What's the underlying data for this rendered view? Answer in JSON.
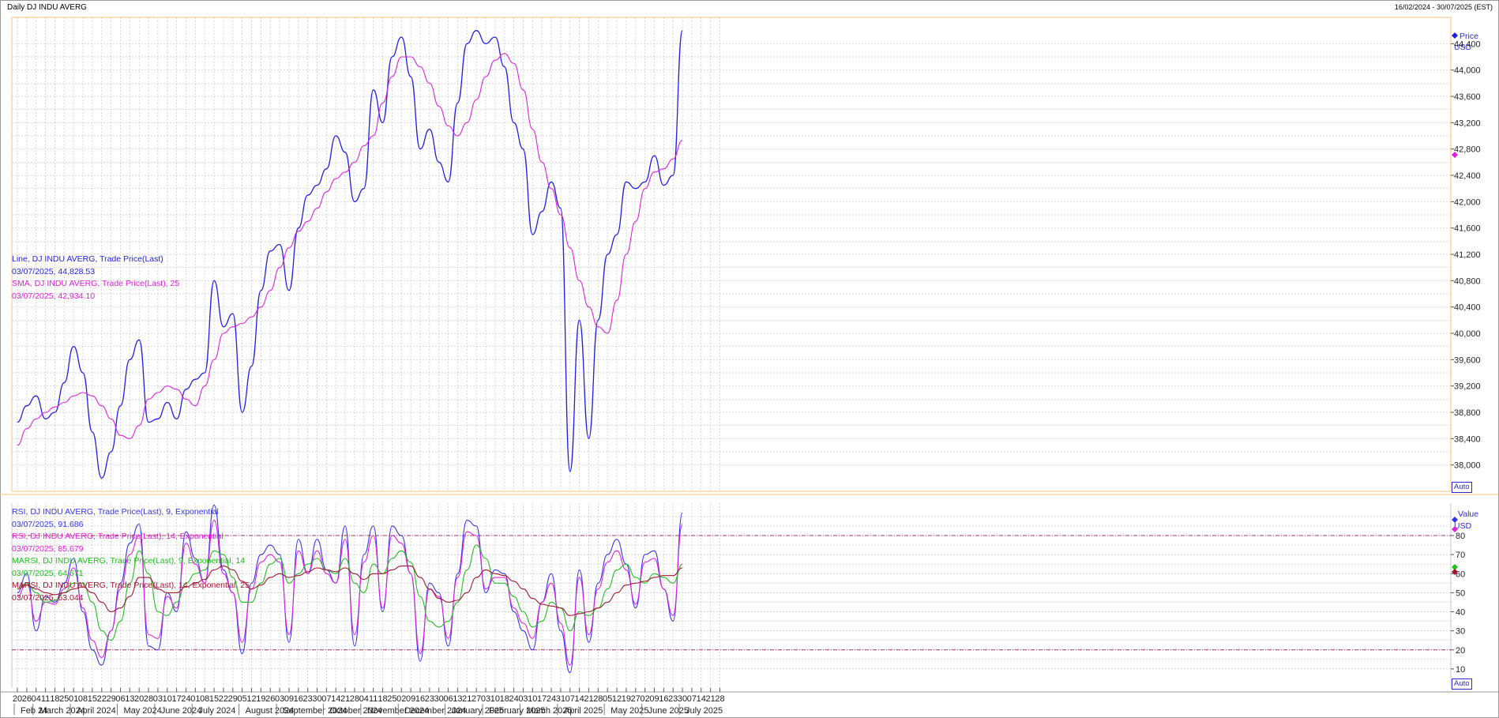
{
  "header": {
    "title": "Daily DJ INDU AVERG",
    "range": "16/02/2024 - 30/07/2025 (EST)"
  },
  "colors": {
    "price": "#1f1fe0",
    "sma": "#e020e0",
    "rsi9": "#3535e8",
    "rsi14": "#e020e0",
    "marsi9": "#20c020",
    "marsi14": "#a01830",
    "refline": "#b03050",
    "grid": "#c6c6c6",
    "selection": "#f5c27a"
  },
  "price_panel": {
    "series_label": "Price",
    "unit": "USD",
    "auto": "Auto",
    "annotations": [
      {
        "text": "Line, DJ INDU AVERG, Trade Price(Last)",
        "color": "#1f1fe0"
      },
      {
        "text": "03/07/2025, 44,828.53",
        "color": "#1f1fe0"
      },
      {
        "text": "SMA, DJ INDU AVERG, Trade Price(Last),  25",
        "color": "#e020e0"
      },
      {
        "text": "03/07/2025, 42,934.10",
        "color": "#e020e0"
      }
    ],
    "y_ticks": [
      "44,400",
      "44,000",
      "43,600",
      "43,200",
      "42,800",
      "42,400",
      "42,000",
      "41,600",
      "41,200",
      "40,800",
      "40,400",
      "40,000",
      "39,600",
      "39,200",
      "38,800",
      "38,400",
      "38,000"
    ]
  },
  "indicator_panel": {
    "series_label": "Value",
    "unit": "USD",
    "auto": "Auto",
    "annotations": [
      {
        "text": "RSI, DJ INDU AVERG, Trade Price(Last),  9, Exponential",
        "color": "#3535e8"
      },
      {
        "text": "03/07/2025, 91.686",
        "color": "#3535e8"
      },
      {
        "text": "RSI, DJ INDU AVERG, Trade Price(Last),  14, Exponential",
        "color": "#e020e0"
      },
      {
        "text": "03/07/2025, 85.679",
        "color": "#e020e0"
      },
      {
        "text": "MARSI, DJ INDU AVERG, Trade Price(Last),  9, Exponential, 14",
        "color": "#20c020"
      },
      {
        "text": "03/07/2025, 64.671",
        "color": "#20c020"
      },
      {
        "text": "MARSI, DJ INDU AVERG, Trade Price(Last),  14, Exponential, 25",
        "color": "#a01830"
      },
      {
        "text": "03/07/2025, 63.044",
        "color": "#a01830"
      }
    ],
    "y_ticks": [
      "80",
      "70",
      "60",
      "50",
      "40",
      "30",
      "20",
      "10"
    ]
  },
  "x_axis": {
    "days": [
      "20",
      "26",
      "04",
      "11",
      "18",
      "25",
      "01",
      "08",
      "15",
      "22",
      "29",
      "06",
      "13",
      "20",
      "28",
      "03",
      "10",
      "17",
      "24",
      "01",
      "08",
      "15",
      "22",
      "29",
      "05",
      "12",
      "19",
      "26",
      "03",
      "09",
      "16",
      "23",
      "30",
      "07",
      "14",
      "21",
      "28",
      "04",
      "11",
      "18",
      "25",
      "02",
      "09",
      "16",
      "23",
      "30",
      "06",
      "13",
      "21",
      "27",
      "03",
      "10",
      "18",
      "24",
      "03",
      "10",
      "17",
      "24",
      "31",
      "07",
      "14",
      "21",
      "28",
      "05",
      "12",
      "19",
      "27",
      "02",
      "09",
      "16",
      "23",
      "30",
      "07",
      "14",
      "21",
      "28"
    ],
    "months": [
      "Feb 24",
      "March 2024",
      "April 2024",
      "May 2024",
      "June 2024",
      "July 2024",
      "August 2024",
      "September 2024",
      "October 2024",
      "November 2024",
      "December 2024",
      "January 2025",
      "February 2025",
      "March 2025",
      "April 2025",
      "May 2025",
      "June 2025",
      "July 2025"
    ]
  },
  "chart_data": [
    {
      "type": "line",
      "title": "Daily DJ INDU AVERG",
      "date_range": "16/02/2024 - 30/07/2025",
      "ylabel": "Price USD",
      "ylim": [
        37600,
        44800
      ],
      "grid": true,
      "x_dates_weekly": [
        "2024-02-20",
        "2024-02-26",
        "2024-03-04",
        "2024-03-11",
        "2024-03-18",
        "2024-03-25",
        "2024-04-01",
        "2024-04-08",
        "2024-04-15",
        "2024-04-22",
        "2024-04-29",
        "2024-05-06",
        "2024-05-13",
        "2024-05-20",
        "2024-05-28",
        "2024-06-03",
        "2024-06-10",
        "2024-06-17",
        "2024-06-24",
        "2024-07-01",
        "2024-07-08",
        "2024-07-15",
        "2024-07-22",
        "2024-07-29",
        "2024-08-05",
        "2024-08-12",
        "2024-08-19",
        "2024-08-26",
        "2024-09-03",
        "2024-09-09",
        "2024-09-16",
        "2024-09-23",
        "2024-09-30",
        "2024-10-07",
        "2024-10-14",
        "2024-10-21",
        "2024-10-28",
        "2024-11-04",
        "2024-11-11",
        "2024-11-18",
        "2024-11-25",
        "2024-12-02",
        "2024-12-09",
        "2024-12-16",
        "2024-12-23",
        "2024-12-30",
        "2025-01-06",
        "2025-01-13",
        "2025-01-21",
        "2025-01-27",
        "2025-02-03",
        "2025-02-10",
        "2025-02-18",
        "2025-02-24",
        "2025-03-03",
        "2025-03-10",
        "2025-03-17",
        "2025-03-24",
        "2025-03-31",
        "2025-04-07",
        "2025-04-14",
        "2025-04-21",
        "2025-04-28",
        "2025-05-05",
        "2025-05-12",
        "2025-05-19",
        "2025-05-27",
        "2025-06-02",
        "2025-06-09",
        "2025-06-16",
        "2025-06-23",
        "2025-06-30"
      ],
      "series": [
        {
          "name": "Line, DJ INDU AVERG, Trade Price(Last)",
          "values": [
            38650,
            38900,
            39050,
            38700,
            38800,
            39250,
            39800,
            39400,
            38500,
            37800,
            38200,
            38900,
            39600,
            39900,
            38650,
            38700,
            38950,
            38700,
            39150,
            39300,
            39400,
            40800,
            40100,
            40300,
            38800,
            39500,
            40650,
            41250,
            41350,
            40650,
            41600,
            42100,
            42250,
            42500,
            43000,
            42750,
            42000,
            42200,
            43700,
            43200,
            44200,
            44500,
            43900,
            42800,
            43100,
            42600,
            42300,
            43500,
            44400,
            44600,
            44400,
            44500,
            44050,
            43200,
            42800,
            41500,
            41850,
            42300,
            41900,
            37900,
            40200,
            38400,
            40200,
            41200,
            41500,
            42300,
            42200,
            42300,
            42700,
            42250,
            42400,
            44600
          ]
        },
        {
          "name": "SMA, DJ INDU AVERG, Trade Price(Last), 25",
          "values": [
            38300,
            38550,
            38700,
            38800,
            38880,
            38950,
            39050,
            39100,
            39050,
            38900,
            38700,
            38450,
            38400,
            38600,
            39000,
            39100,
            39200,
            39150,
            39000,
            38900,
            39200,
            39600,
            40000,
            40100,
            40150,
            40250,
            40400,
            40650,
            41000,
            41300,
            41550,
            41700,
            41900,
            42150,
            42350,
            42450,
            42600,
            42850,
            43000,
            43500,
            43900,
            44200,
            44200,
            44050,
            43800,
            43450,
            43150,
            43000,
            43200,
            43550,
            43900,
            44150,
            44250,
            44100,
            43700,
            43100,
            42600,
            42200,
            41800,
            41300,
            40800,
            40400,
            40100,
            40000,
            40500,
            41200,
            41700,
            42200,
            42450,
            42500,
            42650,
            42934
          ]
        }
      ]
    },
    {
      "type": "line",
      "ylabel": "Value USD",
      "ylim": [
        0,
        97
      ],
      "grid": true,
      "reference_lines": [
        80,
        20
      ],
      "series": [
        {
          "name": "RSI, DJ INDU AVERG, Trade Price(Last), 9, Exponential",
          "values": [
            50,
            60,
            30,
            48,
            45,
            55,
            68,
            40,
            20,
            12,
            30,
            55,
            76,
            86,
            22,
            20,
            50,
            40,
            82,
            68,
            55,
            96,
            62,
            50,
            18,
            55,
            70,
            75,
            70,
            24,
            78,
            60,
            78,
            62,
            55,
            85,
            22,
            70,
            85,
            40,
            85,
            80,
            60,
            14,
            55,
            50,
            22,
            60,
            88,
            85,
            50,
            62,
            60,
            40,
            30,
            20,
            45,
            60,
            30,
            8,
            62,
            24,
            55,
            70,
            78,
            65,
            42,
            70,
            72,
            52,
            35,
            92
          ]
        },
        {
          "name": "RSI, DJ INDU AVERG, Trade Price(Last), 14, Exponential",
          "values": [
            48,
            55,
            35,
            45,
            44,
            52,
            63,
            42,
            25,
            16,
            30,
            52,
            70,
            80,
            28,
            26,
            48,
            42,
            76,
            65,
            55,
            88,
            60,
            50,
            24,
            52,
            66,
            70,
            66,
            28,
            72,
            60,
            72,
            60,
            55,
            78,
            28,
            66,
            80,
            42,
            80,
            76,
            60,
            18,
            52,
            48,
            26,
            58,
            82,
            80,
            52,
            58,
            58,
            42,
            34,
            26,
            45,
            55,
            34,
            12,
            58,
            28,
            52,
            66,
            72,
            62,
            44,
            66,
            68,
            52,
            38,
            86
          ]
        },
        {
          "name": "MARSI, DJ INDU AVERG, Trade Price(Last), 9, Exponential, 14",
          "values": [
            52,
            55,
            50,
            45,
            46,
            50,
            55,
            55,
            45,
            30,
            25,
            35,
            55,
            72,
            60,
            40,
            38,
            45,
            55,
            60,
            62,
            72,
            70,
            58,
            45,
            45,
            55,
            65,
            68,
            55,
            60,
            65,
            68,
            62,
            60,
            68,
            55,
            50,
            65,
            60,
            68,
            72,
            66,
            48,
            35,
            32,
            35,
            45,
            62,
            75,
            68,
            55,
            55,
            48,
            40,
            32,
            35,
            45,
            42,
            30,
            40,
            38,
            42,
            52,
            62,
            65,
            58,
            55,
            60,
            58,
            55,
            65
          ]
        },
        {
          "name": "MARSI, DJ INDU AVERG, Trade Price(Last), 14, Exponential, 25",
          "values": [
            52,
            54,
            52,
            50,
            49,
            50,
            52,
            53,
            50,
            45,
            40,
            42,
            48,
            58,
            58,
            52,
            50,
            50,
            53,
            55,
            57,
            62,
            64,
            62,
            56,
            52,
            54,
            58,
            60,
            58,
            59,
            61,
            63,
            62,
            61,
            63,
            60,
            57,
            60,
            60,
            62,
            64,
            64,
            58,
            52,
            47,
            45,
            46,
            50,
            58,
            62,
            60,
            59,
            56,
            52,
            47,
            44,
            43,
            42,
            38,
            39,
            40,
            42,
            45,
            50,
            54,
            55,
            56,
            58,
            59,
            59,
            63
          ]
        }
      ]
    }
  ]
}
